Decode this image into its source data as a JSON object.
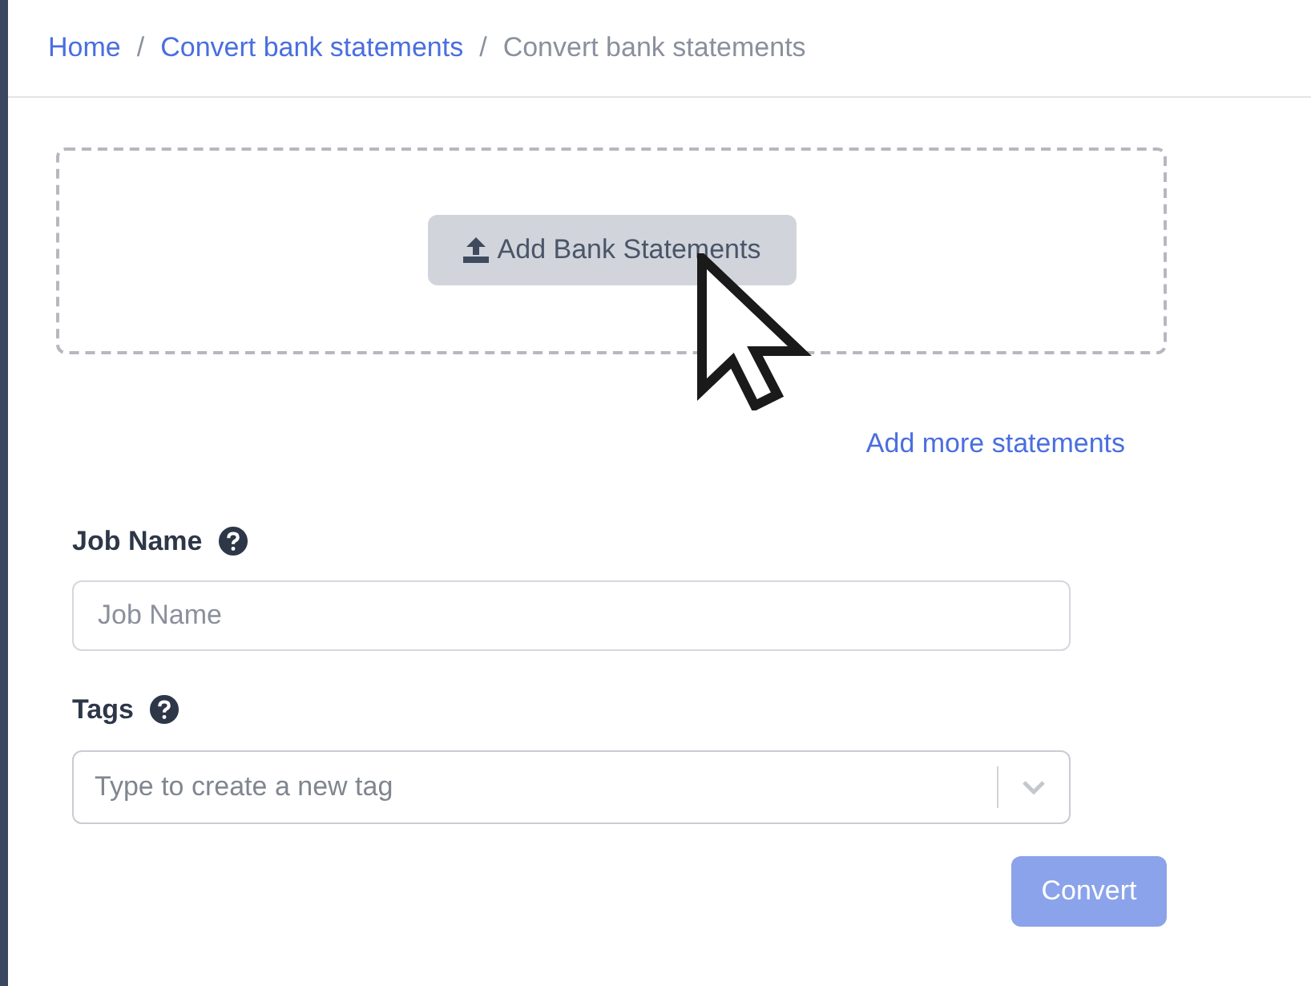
{
  "breadcrumb": [
    {
      "label": "Home",
      "link": true
    },
    {
      "label": "Convert bank statements",
      "link": true
    },
    {
      "label": "Convert bank statements",
      "link": false
    }
  ],
  "breadcrumb_separator": "/",
  "upload": {
    "button": "Add Bank Statements",
    "add_more_link": "Add more statements"
  },
  "form": {
    "fields": [
      {
        "kind": "text",
        "label": "Job Name",
        "placeholder": "Job Name"
      },
      {
        "kind": "select",
        "label": "Tags",
        "placeholder": "Type to create a new tag"
      }
    ],
    "submit": {
      "label": "Convert",
      "disabled": true
    }
  }
}
